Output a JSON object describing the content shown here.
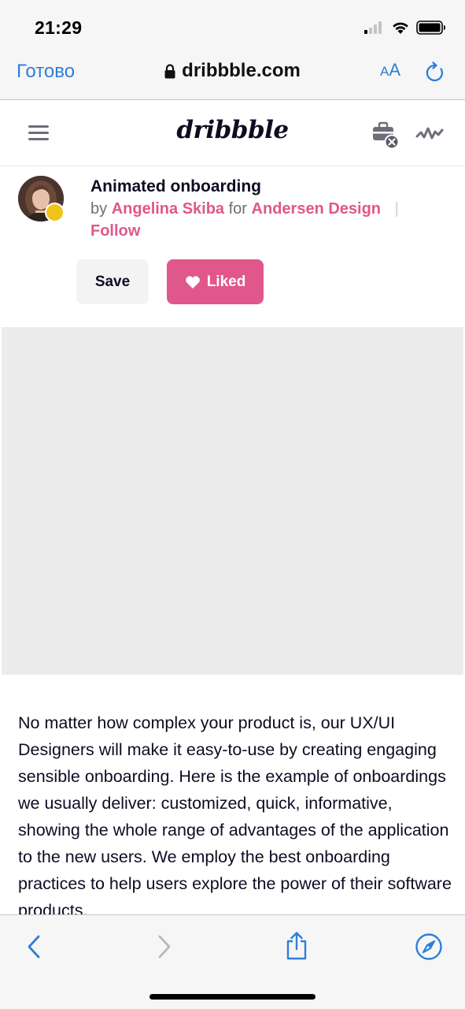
{
  "status_bar": {
    "time": "21:29",
    "icons": [
      "cellular-signal-icon",
      "wifi-icon",
      "battery-icon"
    ]
  },
  "browser": {
    "done_label": "Готово",
    "url": "dribbble.com",
    "text_size_label_small": "A",
    "text_size_label_large": "A",
    "icons": [
      "lock-icon",
      "reload-icon"
    ],
    "accent_color": "#2f7ed8"
  },
  "site_header": {
    "logo_text": "dribbble",
    "icons": [
      "hamburger-menu-icon",
      "briefcase-icon",
      "activity-icon"
    ]
  },
  "shot": {
    "title": "Animated onboarding",
    "by_label": "by",
    "author": "Angelina Skiba",
    "for_label": "for",
    "team": "Andersen Design",
    "separator": "|",
    "follow_label": "Follow",
    "save_label": "Save",
    "liked_label": "Liked",
    "brand_color": "#e0578b"
  },
  "description": {
    "text": "No matter how complex your product is, our UX/UI Designers will make it easy-to-use by creating engaging sensible onboarding. Here is the example of onboardings we usually deliver: customized, quick, informative, showing the whole range of advantages of the application to the new users. We employ the best onboarding practices to help users explore the power of their software products."
  },
  "bottom_bar": {
    "icons": [
      "back-chevron-icon",
      "forward-chevron-icon",
      "share-icon",
      "compass-icon"
    ]
  }
}
